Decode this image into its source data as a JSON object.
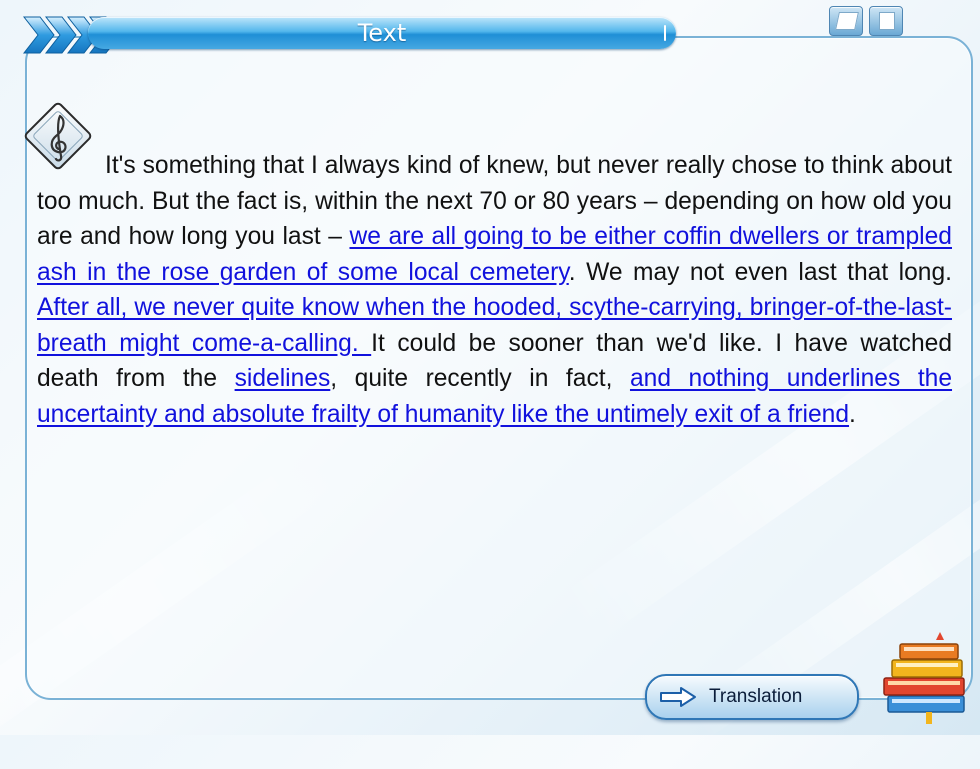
{
  "header": {
    "title": "Text",
    "icons": [
      "cube-icon",
      "document-icon"
    ]
  },
  "passage": {
    "seg1": "It's something that I always kind of knew, but never really chose to think about too much. But the fact is, within the next 70 or 80 years – depending on how old you are and how long you last – ",
    "link1": "we are all going to be either coffin dwellers or trampled ash in the rose garden of some local cemetery",
    "seg2": ". We may not even last that long. ",
    "link2": "After all, we never quite know when the hooded, scythe-carrying, bringer-of-the-last-breath might come-a-calling. ",
    "seg3": "It could be sooner than we'd like. I have watched death from the ",
    "link3": "sidelines",
    "seg4": ", quite recently in fact, ",
    "link4": "and nothing underlines the uncertainty and absolute frailty of humanity like the untimely exit of a friend",
    "seg5": "."
  },
  "translation_button": {
    "label": "Translation",
    "icon": "arrow-right-icon"
  },
  "decor": {
    "music_icon": "treble-clef-icon",
    "books_icon": "books-stack-icon"
  },
  "colors": {
    "accent": "#1f8fd6",
    "link": "#1111dd",
    "panel_border": "#7ab2d6"
  }
}
